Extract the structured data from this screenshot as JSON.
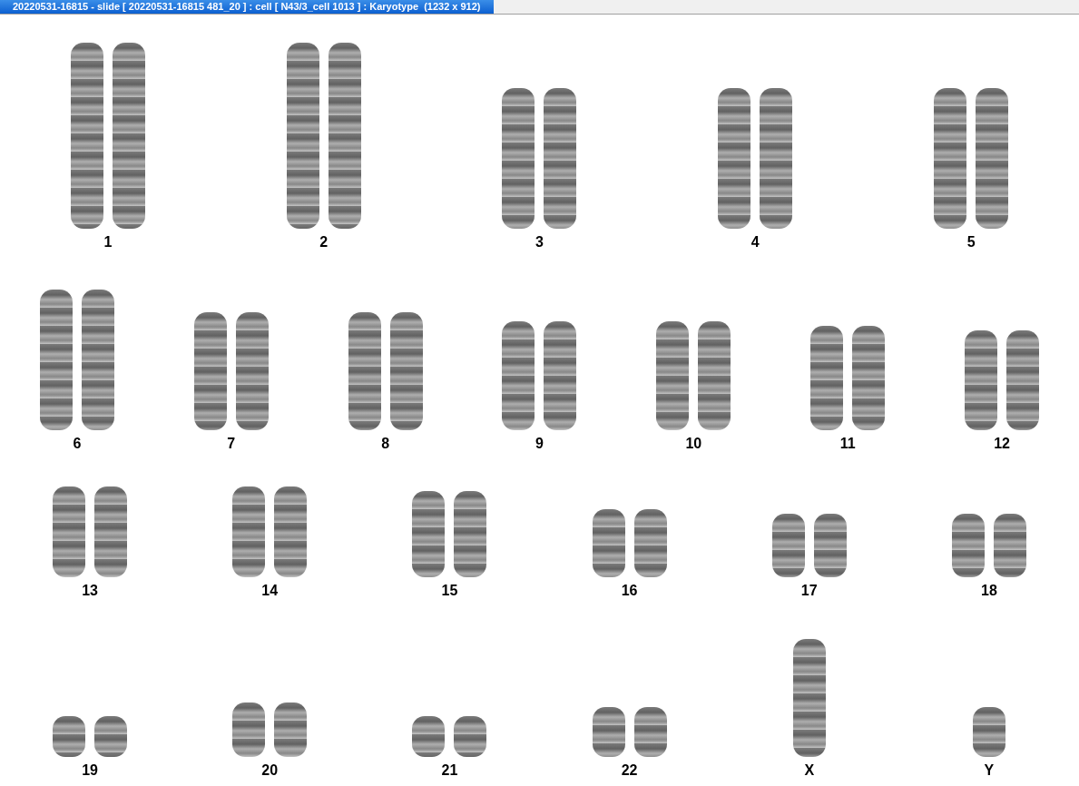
{
  "window": {
    "title": "20220531-16815 - slide [ 20220531-16815 481_20 ] : cell [ N43/3_cell 1013 ] : Karyotype  (1232 x 912)"
  },
  "karyotype": {
    "rows": [
      {
        "groups": [
          {
            "label": "1",
            "kind": "pair"
          },
          {
            "label": "2",
            "kind": "pair"
          },
          {
            "label": "3",
            "kind": "pair"
          },
          {
            "label": "4",
            "kind": "pair"
          },
          {
            "label": "5",
            "kind": "pair"
          }
        ]
      },
      {
        "groups": [
          {
            "label": "6",
            "kind": "pair"
          },
          {
            "label": "7",
            "kind": "pair"
          },
          {
            "label": "8",
            "kind": "pair"
          },
          {
            "label": "9",
            "kind": "pair"
          },
          {
            "label": "10",
            "kind": "pair"
          },
          {
            "label": "11",
            "kind": "pair"
          },
          {
            "label": "12",
            "kind": "pair"
          }
        ]
      },
      {
        "groups": [
          {
            "label": "13",
            "kind": "pair"
          },
          {
            "label": "14",
            "kind": "pair"
          },
          {
            "label": "15",
            "kind": "pair"
          },
          {
            "label": "16",
            "kind": "pair"
          },
          {
            "label": "17",
            "kind": "pair"
          },
          {
            "label": "18",
            "kind": "pair"
          }
        ]
      },
      {
        "groups": [
          {
            "label": "19",
            "kind": "pair"
          },
          {
            "label": "20",
            "kind": "pair"
          },
          {
            "label": "21",
            "kind": "pair"
          },
          {
            "label": "22",
            "kind": "pair"
          },
          {
            "label": "X",
            "kind": "single"
          },
          {
            "label": "Y",
            "kind": "single"
          }
        ]
      }
    ]
  }
}
